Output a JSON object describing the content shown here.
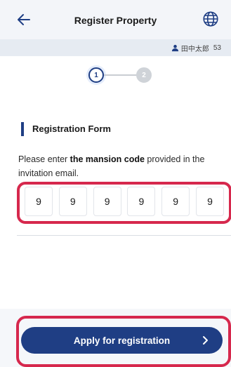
{
  "header": {
    "title": "Register Property"
  },
  "user": {
    "name": "田中太郎",
    "id": "53"
  },
  "stepper": {
    "steps": [
      "1",
      "2"
    ],
    "current": 1
  },
  "form": {
    "section_title": "Registration Form",
    "instruction_before": "Please enter ",
    "instruction_bold": "the mansion code",
    "instruction_after": " provided in the invitation email.",
    "code_digits": [
      "9",
      "9",
      "9",
      "9",
      "9",
      "9"
    ]
  },
  "actions": {
    "apply_label": "Apply for registration"
  },
  "colors": {
    "primary": "#1f3e84",
    "highlight": "#d6284d"
  }
}
